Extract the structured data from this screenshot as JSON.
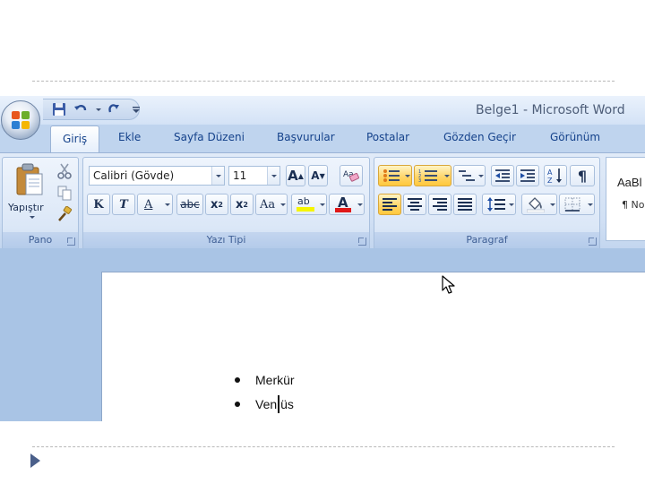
{
  "window": {
    "title": "Belge1 - Microsoft Word"
  },
  "tabs": [
    "Giriş",
    "Ekle",
    "Sayfa Düzeni",
    "Başvurular",
    "Postalar",
    "Gözden Geçir",
    "Görünüm"
  ],
  "ribbon": {
    "groups": {
      "clipboard": {
        "label": "Pano",
        "paste_label": "Yapıştır"
      },
      "font": {
        "label": "Yazı Tipi",
        "font_name": "Calibri (Gövde)",
        "font_size": "11"
      },
      "paragraph": {
        "label": "Paragraf"
      }
    },
    "font_buttons": {
      "bold": "K",
      "italic": "T",
      "underline": "A",
      "strike": "abc",
      "sub_x": "x",
      "sub_n": "2",
      "sup_x": "x",
      "sup_n": "2",
      "case": "Aa",
      "grow": "A",
      "shrink": "A",
      "highlight": "ab",
      "color": "A"
    },
    "styles": {
      "sample1": "AaBl",
      "sample2": "¶ No"
    }
  },
  "document": {
    "list_items": [
      {
        "text": "Merkür"
      },
      {
        "text_before_caret": "Ven",
        "text_after_caret": "üs"
      }
    ]
  },
  "colors": {
    "highlight": "#f5f500",
    "font_color": "#e01818",
    "accent": "#15428b"
  }
}
